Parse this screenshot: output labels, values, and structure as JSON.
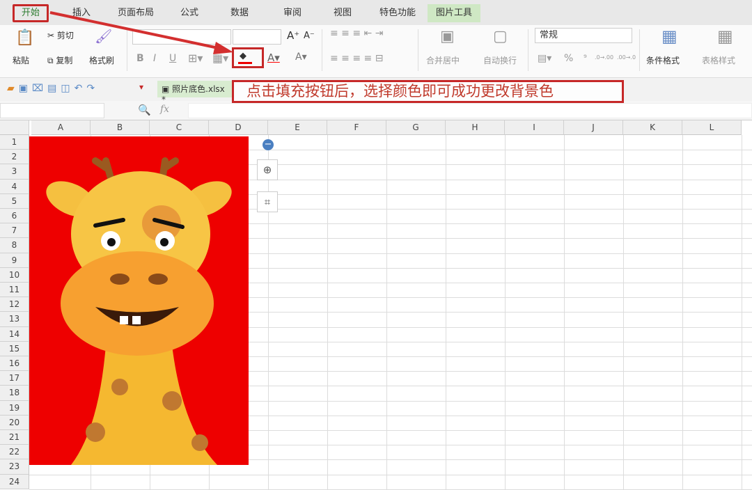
{
  "tabs": [
    "开始",
    "插入",
    "页面布局",
    "公式",
    "数据",
    "审阅",
    "视图",
    "特色功能",
    "图片工具"
  ],
  "ribbon": {
    "cut": "剪切",
    "copy": "复制",
    "paste": "粘贴",
    "format_painter": "格式刷",
    "bold": "B",
    "italic": "I",
    "underline": "U",
    "font_grow": "A⁺",
    "font_shrink": "A⁻",
    "merge_center": "合并居中",
    "wrap_text": "自动换行",
    "number_format": "常规",
    "percent": "%",
    "thousands": "⁹",
    "dec_inc": ".0→.00",
    "dec_dec": ".00→.0",
    "conditional_format": "条件格式",
    "table_style": "表格样式"
  },
  "quick": {
    "file_name": "照片底色.xlsx",
    "modified": "*"
  },
  "formula": {
    "fx": "fx"
  },
  "callout": "点击填充按钮后，选择颜色即可成功更改背景色",
  "columns": [
    "A",
    "B",
    "C",
    "D",
    "E",
    "F",
    "G",
    "H",
    "I",
    "J",
    "K",
    "L"
  ],
  "rows": [
    "1",
    "2",
    "3",
    "4",
    "5",
    "6",
    "7",
    "8",
    "9",
    "10",
    "11",
    "12",
    "13",
    "14",
    "15",
    "16",
    "17",
    "18",
    "19",
    "20",
    "21",
    "22",
    "23",
    "24"
  ],
  "colors": {
    "accent": "#c62828",
    "image_bg": "#ee0000"
  }
}
